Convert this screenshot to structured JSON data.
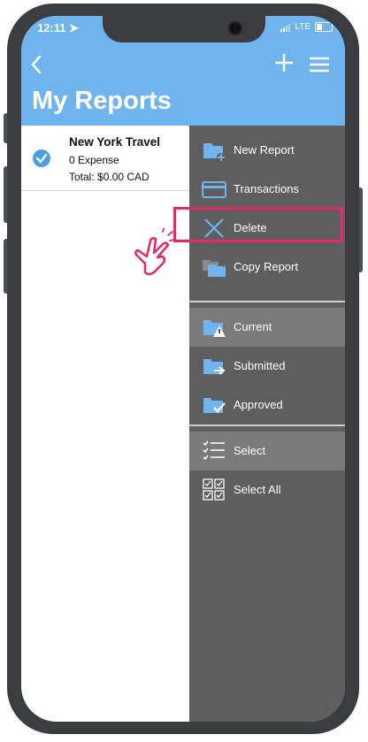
{
  "status": {
    "time": "12:11",
    "network": "LTE"
  },
  "header": {
    "title": "My Reports"
  },
  "report": {
    "name": "New York Travel",
    "count": "0 Expense",
    "total": "Total: $0.00 CAD"
  },
  "menu": [
    {
      "label": "New Report",
      "icon": "folder-plus-icon"
    },
    {
      "label": "Transactions",
      "icon": "card-icon"
    },
    {
      "label": "Delete",
      "icon": "x-icon"
    },
    {
      "label": "Copy Report",
      "icon": "copy-folder-icon"
    },
    {
      "label": "Current",
      "icon": "warning-folder-icon"
    },
    {
      "label": "Submitted",
      "icon": "arrow-folder-icon"
    },
    {
      "label": "Approved",
      "icon": "check-folder-icon"
    },
    {
      "label": "Select",
      "icon": "checklist-icon"
    },
    {
      "label": "Select All",
      "icon": "checkbox-grid-icon"
    }
  ],
  "colors": {
    "header": "#6fb3ef",
    "drawer": "#5e5e5e",
    "drawer_active": "#7a7a7a",
    "accent": "#4a9fe6",
    "highlight": "#e8266c"
  }
}
